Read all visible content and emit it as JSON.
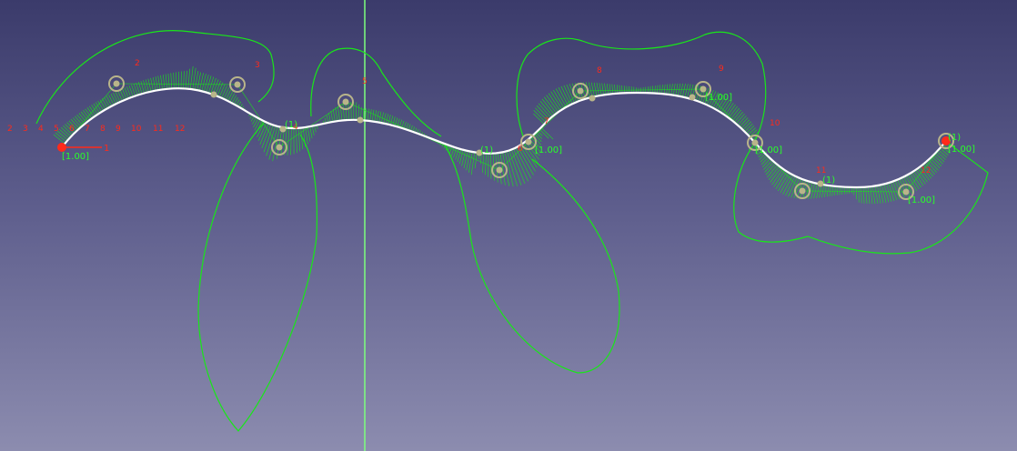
{
  "viewport": {
    "background_top": "#3b3b6b",
    "background_bottom": "#8c8caf",
    "axis_color": "#7dff7d",
    "curve_color": "#ffffff",
    "comb_color": "#19e619",
    "pole_color": "#b9b58a",
    "constraint_color": "#ff2a1a",
    "dimension_color": "#28ff28"
  },
  "sketch": {
    "start_point_label": "1",
    "knot_multiplicity_labels": {
      "n1": "(1)",
      "n2": "(1)",
      "n3": "(1)",
      "n4": "(1)"
    },
    "weight_labels": {
      "w_start": "[1.00]",
      "w_p5": "[1.00]",
      "w_p8": "[1.00]",
      "w_p12": "[1.00]",
      "w_p10": "[1.00]",
      "w_p6": "[1.00]"
    },
    "constraint_label_row": [
      "2",
      "3",
      "4",
      "5",
      "6",
      "7",
      "8",
      "9",
      "10",
      "11",
      "12"
    ],
    "pole_markers": {
      "c2": "2",
      "c3": "3",
      "c4": "4",
      "c5": "5",
      "c6": "6",
      "c7": "7",
      "c8": "8",
      "c9": "9",
      "c10": "10",
      "c11": "11",
      "c12": "12"
    }
  }
}
